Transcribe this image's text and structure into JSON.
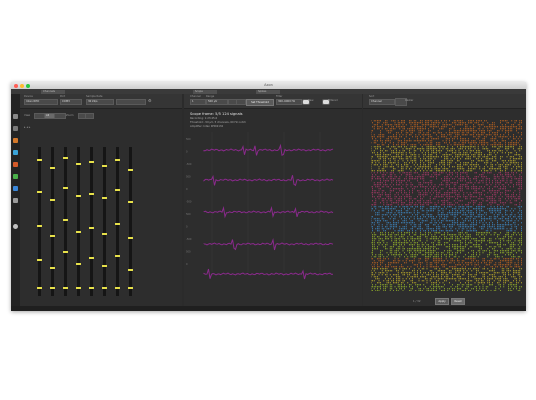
{
  "window": {
    "title": "Axon",
    "tabs": [
      "Channels",
      "Scope",
      "Spikes"
    ],
    "traffic_colors": [
      "#ff5f57",
      "#febc2e",
      "#28c840"
    ]
  },
  "left_panel": {
    "device_label": "Device",
    "device_value": "Intan RHD",
    "port_label": "Port",
    "port_value": "COM3",
    "rate_label": "Sample Rate",
    "rate_value": "30 kS/s",
    "view_label": "View",
    "view_value": "All",
    "zoom_label": "Zoom",
    "meter_colors": [
      "#e6e04a"
    ]
  },
  "center_panel": {
    "toolbar": {
      "channel_label": "Channel",
      "channel_value": "1",
      "range_label": "Range",
      "range_value": "500 µV",
      "trigger_button": "Set Threshold",
      "filter_label": "Filter",
      "filter_value": "300–6000 Hz",
      "toggle_a": "Raw",
      "toggle_b": "Filtered"
    },
    "scope": {
      "title": "Scope frame: 5/5 124 signals",
      "line1": "Recording: 1:23:45.6",
      "line2": "Threshold: -50 µV, 5 channels, 60 Hz notch",
      "line3": "Amplifier: Intan RHD2132",
      "trace_color": "#8a2a8c",
      "y_ticks": [
        "500",
        "0",
        "-500",
        "500",
        "0",
        "-500",
        "500",
        "0",
        "-500",
        "500",
        "0"
      ]
    }
  },
  "right_panel": {
    "toolbar": {
      "sort_label": "Sort",
      "sort_value": "Channel",
      "raster_label": "Raster"
    },
    "raster_band_colors": [
      "#c8681f",
      "#c7b52a",
      "#b23a6c",
      "#3f8fd0",
      "#9fbf2a"
    ],
    "footer": {
      "count_text": "1 / 32",
      "apply_button": "Apply",
      "reset_button": "Reset"
    }
  }
}
